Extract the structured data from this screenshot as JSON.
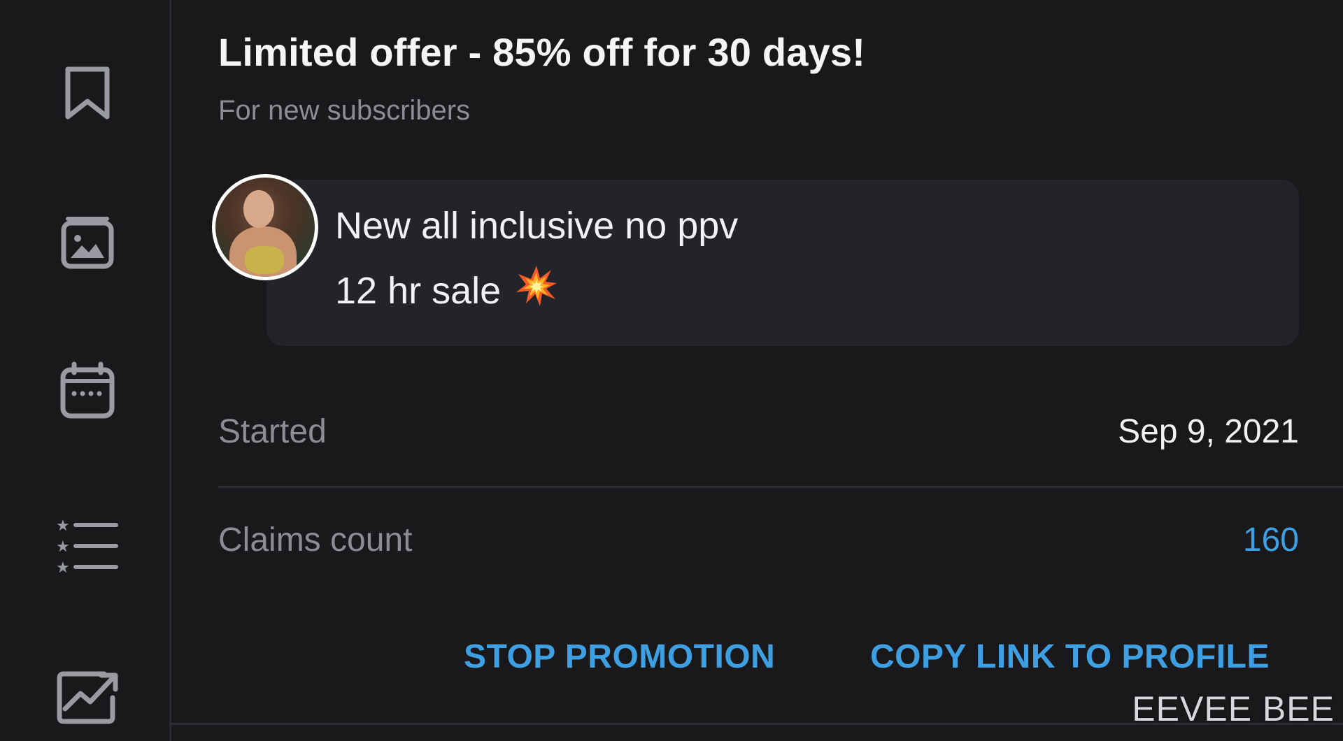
{
  "sidebar": {
    "items": [
      {
        "icon": "bookmark-icon"
      },
      {
        "icon": "image-gallery-icon"
      },
      {
        "icon": "calendar-icon"
      },
      {
        "icon": "starred-list-icon"
      },
      {
        "icon": "statistics-icon"
      }
    ]
  },
  "offer": {
    "title": "Limited offer - 85% off for 30 days!",
    "subtitle": "For new subscribers",
    "message_line1": "New all inclusive no ppv",
    "message_line2": "12 hr sale",
    "message_emoji": "collision-emoji"
  },
  "details": {
    "started_label": "Started",
    "started_value": "Sep 9, 2021",
    "claims_label": "Claims count",
    "claims_value": "160"
  },
  "actions": {
    "stop_label": "STOP PROMOTION",
    "copy_label": "COPY LINK TO PROFILE"
  },
  "watermark": "EEVEE BEE",
  "colors": {
    "background": "#19191c",
    "bubble": "#232429",
    "accent": "#3ea0e2",
    "muted_text": "#8c8d94",
    "primary_text": "#f2f2f4"
  }
}
